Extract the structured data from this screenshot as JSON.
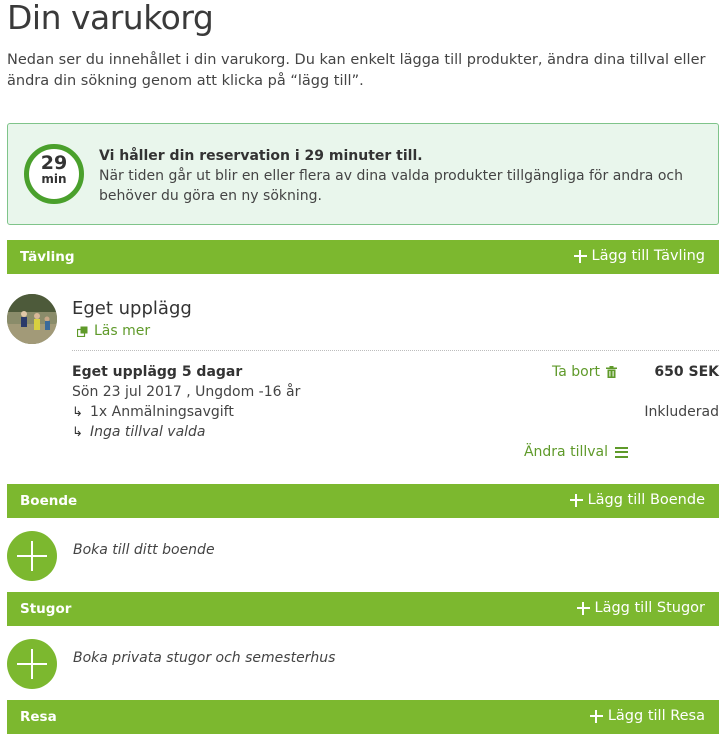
{
  "page": {
    "title": "Din varukorg",
    "intro": "Nedan ser du innehållet i din varukorg. Du kan enkelt lägga till produkter, ändra dina tillval eller ändra din sökning genom att klicka på “lägg till”."
  },
  "timer": {
    "minutes": "29",
    "unit": "min",
    "title": "Vi håller din reservation i 29 minuter till.",
    "message": "När tiden går ut blir en eller flera av dina valda produkter tillgängliga för andra och behöver du göra en ny sökning."
  },
  "sections": {
    "tavling": {
      "title": "Tävling",
      "add_label": "Lägg till Tävling"
    },
    "boende": {
      "title": "Boende",
      "add_label": "Lägg till Boende",
      "empty_text": "Boka till ditt boende"
    },
    "stugor": {
      "title": "Stugor",
      "add_label": "Lägg till Stugor",
      "empty_text": "Boka privata stugor och semesterhus"
    },
    "resa": {
      "title": "Resa",
      "add_label": "Lägg till Resa"
    }
  },
  "product": {
    "title": "Eget upplägg",
    "read_more": "Läs mer",
    "item_name": "Eget upplägg 5 dagar",
    "item_details": "Sön 23 jul 2017 , Ungdom -16 år",
    "fee": "1x Anmälningsavgift",
    "fee_status": "Inkluderad",
    "no_addons": "Inga tillval valda",
    "remove_label": "Ta bort",
    "price": "650 SEK",
    "change_label": "Ändra tillval"
  },
  "colors": {
    "accent_green": "#7cb82f",
    "link_green": "#5f9a2a",
    "timer_bg": "#e9f6ec"
  }
}
